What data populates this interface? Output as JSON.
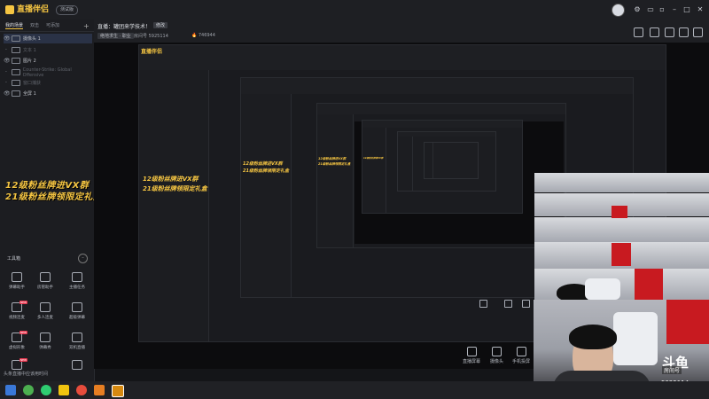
{
  "app": {
    "logo_text": "直播伴侣",
    "version_badge": "测试版",
    "window_controls": [
      "minimize-icon",
      "maximize-icon",
      "close-icon"
    ]
  },
  "scene_tabs": [
    "我的场景",
    "双击",
    "可添加"
  ],
  "sources": [
    {
      "label": "摄像头 1",
      "state": "selected"
    },
    {
      "label": "文本 1",
      "state": "dim"
    },
    {
      "label": "图片 2",
      "state": "normal"
    },
    {
      "label": "Counter-Strike: Global Offensive",
      "state": "dim"
    },
    {
      "label": "窗口捕获",
      "state": "dim"
    },
    {
      "label": "全屏 1",
      "state": "normal"
    }
  ],
  "overlay_text": {
    "line1": "12级粉丝牌进VX群",
    "line2": "21级粉丝牌领限定礼盒"
  },
  "tools": {
    "title": "工具箱",
    "items": [
      {
        "label": "弹幕助手",
        "icon": "danmu-icon",
        "tag": ""
      },
      {
        "label": "房管助手",
        "icon": "admin-icon",
        "tag": ""
      },
      {
        "label": "主播任务",
        "icon": "task-icon",
        "tag": ""
      },
      {
        "label": "视频连麦",
        "icon": "video-link-icon",
        "tag": "NEW"
      },
      {
        "label": "多人连麦",
        "icon": "multi-link-icon",
        "tag": ""
      },
      {
        "label": "超级弹幕",
        "icon": "super-danmu-icon",
        "tag": ""
      },
      {
        "label": "虚拟形象",
        "icon": "avatar-icon",
        "tag": "NEW"
      },
      {
        "label": "弹幕秀",
        "icon": "danmu-show-icon",
        "tag": ""
      },
      {
        "label": "双机直播",
        "icon": "dual-icon",
        "tag": ""
      },
      {
        "label": "贴纸",
        "icon": "sticker-icon",
        "tag": "NEW"
      },
      {
        "label": "",
        "icon": "more-icon",
        "tag": ""
      },
      {
        "label": "",
        "icon": "more2-icon",
        "tag": ""
      }
    ]
  },
  "stream": {
    "title_prefix": "直播：",
    "title": "罐团来学技术！",
    "edit_label": "修改",
    "category": "绝地求生 · 职业",
    "room_label": "房间号",
    "room_number": "5925114",
    "viewers": "746944"
  },
  "preview_bottom_tools": [
    {
      "label": "直播屏幕",
      "icon": "screen-icon"
    },
    {
      "label": "摄像头",
      "icon": "camera-icon"
    },
    {
      "label": "手机投屏",
      "icon": "phone-icon"
    }
  ],
  "webcam": {
    "platform_logo": "斗鱼",
    "badge": "房间号",
    "room_number": "5925114"
  },
  "ticker": "头条直播中应该用时间",
  "colors": {
    "accent": "#f5c542",
    "panel_bg": "#1c1d21",
    "poster_red": "#c81a20"
  }
}
